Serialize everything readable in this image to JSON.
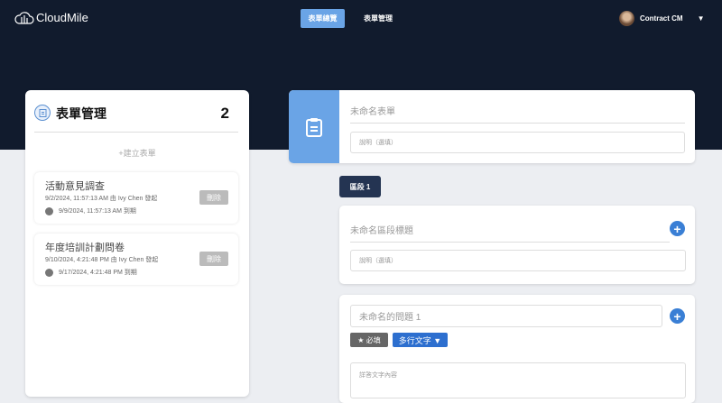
{
  "nav": {
    "brand": "CloudMile",
    "tabs": [
      "表單總覽",
      "表單管理"
    ],
    "user": "Contract CM",
    "caret": "▼"
  },
  "left": {
    "title": "表單管理",
    "count": "2",
    "create": "+建立表單",
    "items": [
      {
        "name": "活動意見調查",
        "meta": "9/2/2024, 11:57:13 AM 由 Ivy Chen 發起",
        "due": "9/9/2024, 11:57:13 AM 到期",
        "delete": "刪除"
      },
      {
        "name": "年度培訓計劃問卷",
        "meta": "9/10/2024, 4:21:48 PM 由 Ivy Chen 發起",
        "due": "9/17/2024, 4:21:48 PM 到期",
        "delete": "刪除"
      }
    ]
  },
  "form": {
    "title_placeholder": "未命名表單",
    "desc_placeholder": "說明（選填）",
    "section": {
      "label": "區段 1",
      "title_placeholder": "未命名區段標題",
      "desc_placeholder": "說明（選填）"
    },
    "question": {
      "title_placeholder": "未命名的問題 1",
      "required": "★ 必填",
      "type": "多行文字 ▼",
      "answer_placeholder": "詳答文字內容"
    }
  }
}
